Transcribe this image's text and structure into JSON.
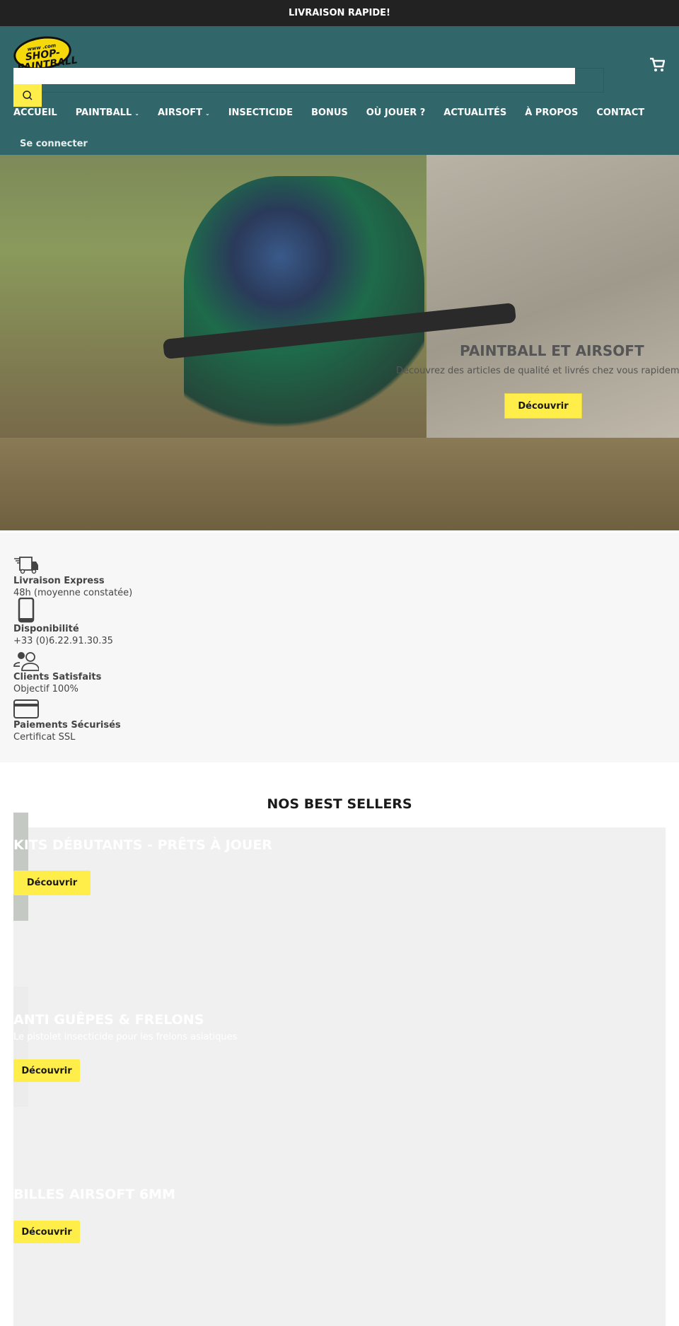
{
  "topbar": {
    "text": "LIVRAISON RAPIDE!"
  },
  "header": {
    "logo_text": "SHOP-PAINTBALL",
    "logo_small": "www .com",
    "search": {
      "value": "",
      "placeholder": ""
    },
    "nav": [
      {
        "label": "ACCUEIL"
      },
      {
        "label": "PAINTBALL",
        "dropdown": true
      },
      {
        "label": "AIRSOFT",
        "dropdown": true
      },
      {
        "label": "INSECTICIDE"
      },
      {
        "label": "BONUS"
      },
      {
        "label": "OÙ JOUER ?"
      },
      {
        "label": "ACTUALITÉS"
      },
      {
        "label": "À PROPOS"
      },
      {
        "label": "CONTACT"
      }
    ],
    "login": "Se connecter",
    "chevron": "⌄"
  },
  "hero": {
    "title": "PAINTBALL ET AIRSOFT",
    "subtitle": "Découvrez des articles de qualité et livrés chez vous rapidement",
    "button": "Découvrir"
  },
  "features": [
    {
      "icon": "truck-icon",
      "title": "Livraison Express",
      "text": "48h (moyenne constatée)"
    },
    {
      "icon": "phone-icon",
      "title": "Disponibilité",
      "text": "+33 (0)6.22.91.30.35"
    },
    {
      "icon": "users-icon",
      "title": "Clients Satisfaits",
      "text": "Objectif 100%"
    },
    {
      "icon": "credit-card-icon",
      "title": "Paiements Sécurisés",
      "text": "Certificat SSL"
    }
  ],
  "bestsellers": {
    "title": "NOS BEST SELLERS",
    "items": [
      {
        "title": "KITS DÉBUTANTS - PRÊTS À JOUER",
        "button": "Découvrir"
      },
      {
        "title": "ANTI GUÊPES & FRELONS",
        "subtitle": "Le pistolet insecticide pour les frelons asiatiques",
        "button": "Découvrir"
      },
      {
        "title": "BILLES AIRSOFT 6MM",
        "button": "Découvrir"
      }
    ]
  },
  "colors": {
    "header": "#31666b",
    "accent": "#ffed4a",
    "topbar": "#222222"
  }
}
